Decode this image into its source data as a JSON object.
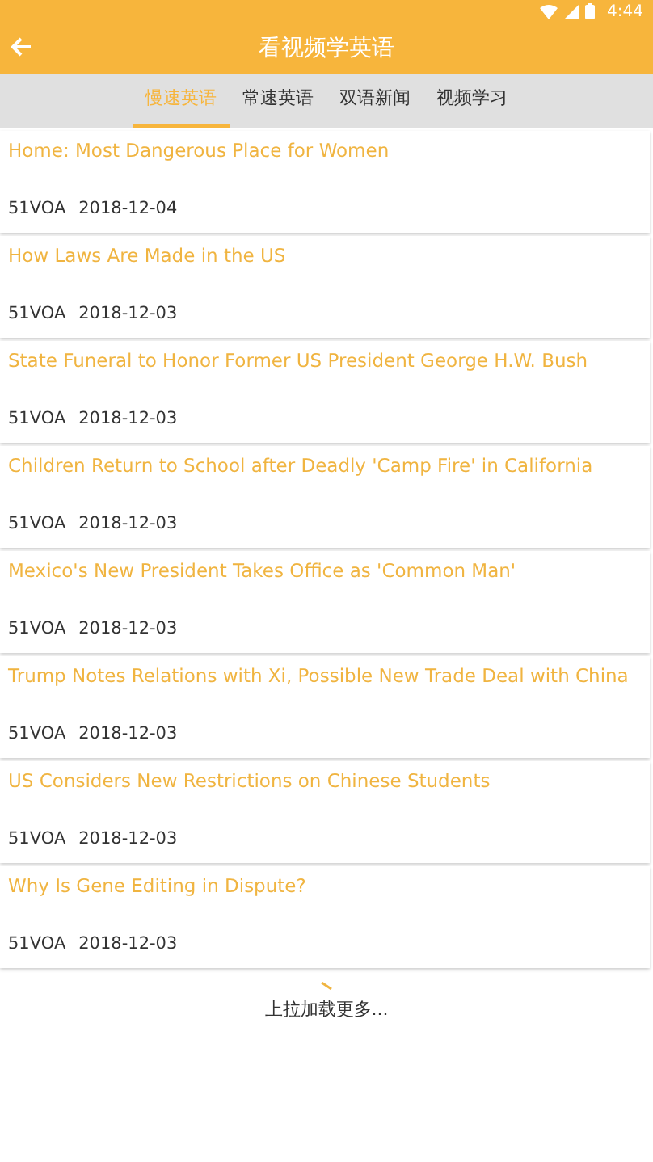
{
  "status_bar": {
    "time": "4:44"
  },
  "app_bar": {
    "title": "看视频学英语"
  },
  "tabs": [
    {
      "label": "慢速英语",
      "selected": true
    },
    {
      "label": "常速英语",
      "selected": false
    },
    {
      "label": "双语新闻",
      "selected": false
    },
    {
      "label": "视频学习",
      "selected": false
    }
  ],
  "articles": [
    {
      "title": "Home: Most Dangerous Place for Women",
      "source": "51VOA",
      "date": "2018-12-04"
    },
    {
      "title": "How Laws Are Made in the US",
      "source": "51VOA",
      "date": "2018-12-03"
    },
    {
      "title": "State Funeral to Honor Former US President George H.W. Bush",
      "source": "51VOA",
      "date": "2018-12-03"
    },
    {
      "title": "Children Return to School after Deadly 'Camp Fire' in California",
      "source": "51VOA",
      "date": "2018-12-03"
    },
    {
      "title": "Mexico's New President Takes Office as 'Common Man'",
      "source": "51VOA",
      "date": "2018-12-03"
    },
    {
      "title": "Trump Notes Relations with Xi, Possible New Trade Deal with China",
      "source": "51VOA",
      "date": "2018-12-03"
    },
    {
      "title": "US Considers New Restrictions on Chinese Students",
      "source": "51VOA",
      "date": "2018-12-03"
    },
    {
      "title": "Why Is Gene Editing in Dispute?",
      "source": "51VOA",
      "date": "2018-12-03"
    }
  ],
  "footer": {
    "text": "上拉加载更多..."
  }
}
